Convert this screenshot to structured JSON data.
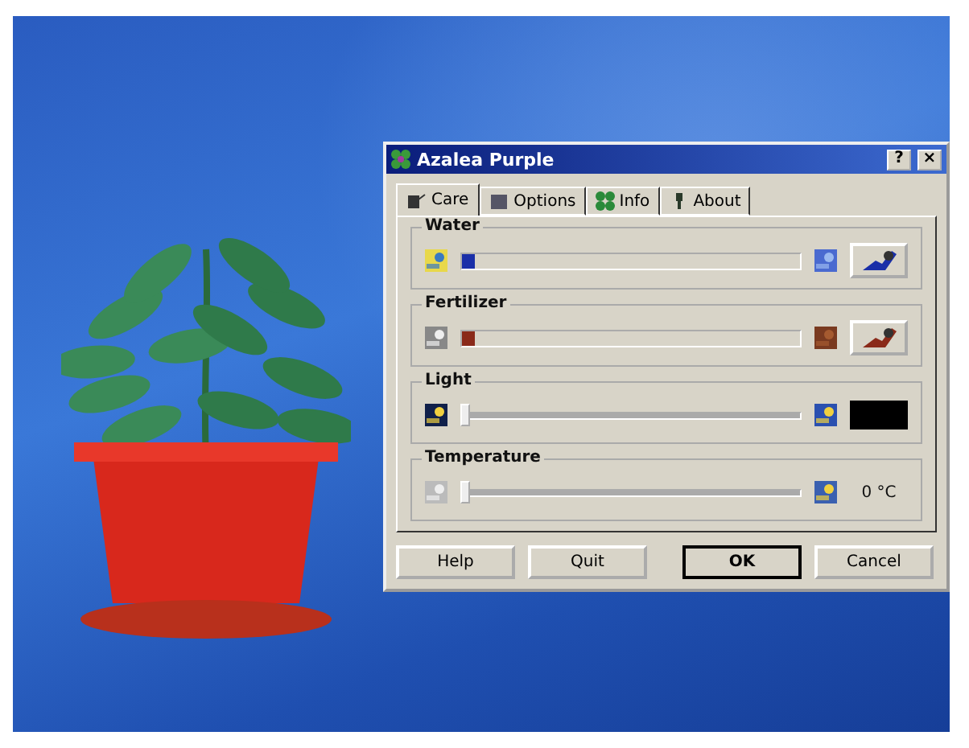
{
  "window": {
    "title": "Azalea Purple",
    "help": "?",
    "close": "×"
  },
  "tabs": [
    {
      "label": "Care",
      "selected": true
    },
    {
      "label": "Options",
      "selected": false
    },
    {
      "label": "Info",
      "selected": false
    },
    {
      "label": "About",
      "selected": false
    }
  ],
  "groups": [
    {
      "title": "Water",
      "kind": "meter",
      "level": 0.04,
      "color": "#1a2fa8"
    },
    {
      "title": "Fertilizer",
      "kind": "meter",
      "level": 0.04,
      "color": "#8a2a1a"
    },
    {
      "title": "Light",
      "kind": "swatch",
      "level": 0
    },
    {
      "title": "Temperature",
      "kind": "reading",
      "level": 0,
      "reading": "0 °C"
    }
  ],
  "buttons": [
    {
      "label": "Help",
      "default": false
    },
    {
      "label": "Quit",
      "default": false
    },
    {
      "label": "OK",
      "default": true
    },
    {
      "label": "Cancel",
      "default": false
    }
  ]
}
